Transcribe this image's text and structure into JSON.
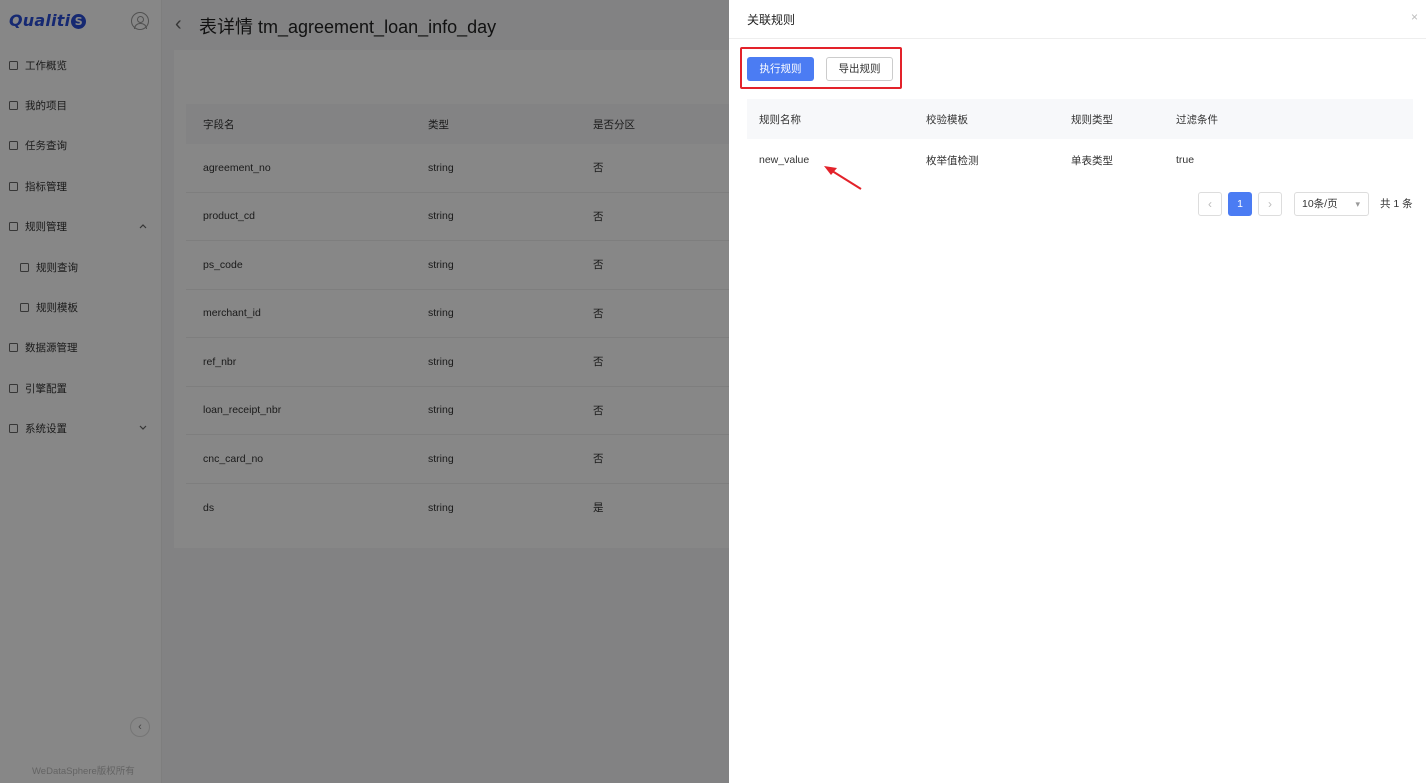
{
  "app": {
    "logo": "Qualiti",
    "logo_badge": "S",
    "copyright": "WeDataSphere版权所有"
  },
  "sidebar": {
    "items": [
      {
        "label": "工作概览",
        "icon": "overview-icon"
      },
      {
        "label": "我的项目",
        "icon": "folder-icon"
      },
      {
        "label": "任务查询",
        "icon": "task-icon"
      },
      {
        "label": "指标管理",
        "icon": "metric-icon"
      },
      {
        "label": "规则管理",
        "icon": "rule-icon",
        "expanded": true
      },
      {
        "label": "规则查询",
        "icon": "rule-query-icon",
        "sub": true
      },
      {
        "label": "规则模板",
        "icon": "rule-template-icon",
        "sub": true
      },
      {
        "label": "数据源管理",
        "icon": "datasource-icon"
      },
      {
        "label": "引擎配置",
        "icon": "engine-icon"
      },
      {
        "label": "系统设置",
        "icon": "settings-icon",
        "expanded": false
      }
    ]
  },
  "main": {
    "title": "表详情 tm_agreement_loan_info_day",
    "columns": [
      "字段名",
      "类型",
      "是否分区"
    ],
    "rows": [
      [
        "agreement_no",
        "string",
        "否"
      ],
      [
        "product_cd",
        "string",
        "否"
      ],
      [
        "ps_code",
        "string",
        "否"
      ],
      [
        "merchant_id",
        "string",
        "否"
      ],
      [
        "ref_nbr",
        "string",
        "否"
      ],
      [
        "loan_receipt_nbr",
        "string",
        "否"
      ],
      [
        "cnc_card_no",
        "string",
        "否"
      ],
      [
        "ds",
        "string",
        "是"
      ]
    ]
  },
  "drawer": {
    "title": "关联规则",
    "close": "×",
    "execute_button": "执行规则",
    "export_button": "导出规则",
    "columns": [
      "规则名称",
      "校验模板",
      "规则类型",
      "过滤条件"
    ],
    "rows": [
      [
        "new_value",
        "枚举值检测",
        "单表类型",
        "true"
      ]
    ],
    "pagination": {
      "prev": "‹",
      "current": "1",
      "next": "›",
      "page_size": "10条/页",
      "total": "共 1 条"
    }
  },
  "colors": {
    "primary": "#4b7cf3",
    "highlight": "#e3222a",
    "logo": "#2b4fd8"
  }
}
